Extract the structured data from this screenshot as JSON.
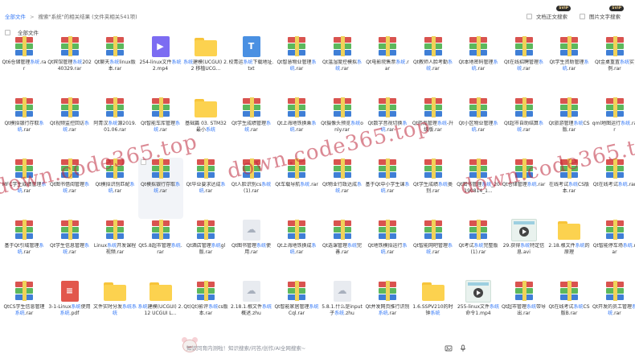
{
  "header": {
    "breadcrumb_root": "全部文件",
    "breadcrumb_sep": ">",
    "breadcrumb_current": "搜索\"系统\"的相关结果 (文件夹相关541项)",
    "option_fulltext": "文档正文搜索",
    "option_image": "图片文字搜索",
    "svip_badge": "SVIP",
    "select_all": "全部文件"
  },
  "watermark": "down.code365.top",
  "items": [
    {
      "icon": "rar",
      "name": "Qt6仓储管理系统.rar"
    },
    {
      "icon": "rar",
      "name": "Qt宾馆管理系统20240329.rar"
    },
    {
      "icon": "rar",
      "name": "Qt聊天系统linux版本.rar"
    },
    {
      "icon": "video",
      "name": "254-linux文件系统2.mp4"
    },
    {
      "icon": "folder",
      "name": "系统建模(UCGUI) 2.2 移植UCG..."
    },
    {
      "icon": "txt",
      "name": "校青运系统下载地址.txt"
    },
    {
      "icon": "rar",
      "name": "Qt智慧物业管理系统.rar"
    },
    {
      "icon": "rar",
      "name": "Qt温湿度控模拟系统.rar"
    },
    {
      "icon": "rar",
      "name": "Qt电影院售票系统.rar"
    },
    {
      "icon": "rar",
      "name": "Qt教师人脸考勤系统.rar"
    },
    {
      "icon": "rar",
      "name": "Qt本地密码管理系统.rar"
    },
    {
      "icon": "rar",
      "name": "Qt在线招聘管理系统.rar"
    },
    {
      "icon": "rar",
      "name": "Qt学生资助管理系统.rar"
    },
    {
      "icon": "rar",
      "name": "Qt金桌重置系统实例.rar"
    },
    {
      "icon": "rar",
      "name": "Qt模拟银行存取系统.rar"
    },
    {
      "icon": "rar",
      "name": "Qt视频监控回访系统.rar"
    },
    {
      "icon": "rar",
      "name": "阿青汉系统源2019.01.06.rar"
    },
    {
      "icon": "rar",
      "name": "Qt智能车库管理系统.rar"
    },
    {
      "icon": "folder",
      "name": "基础篇 03. STM32 最小系统"
    },
    {
      "icon": "rar",
      "name": "Qt学生成绩管理系统.rar"
    },
    {
      "icon": "rar",
      "name": "Qt上海地铁换乘系统.rar"
    },
    {
      "icon": "rar",
      "name": "Qt摄像头预览系统only.rar"
    },
    {
      "icon": "rar",
      "name": "Qt数字音视切换系统.rar"
    },
    {
      "icon": "rar",
      "name": "Qt药品管理系统-升级版.rar"
    },
    {
      "icon": "rar",
      "name": "Qt小区物业管理系统.rar"
    },
    {
      "icon": "rar",
      "name": "Qt超市自助结算系统.rar"
    },
    {
      "icon": "rar",
      "name": "Qt旅游管理系统CS版.rar"
    },
    {
      "icon": "rar",
      "name": "qml地图运行系统.rar"
    },
    {
      "icon": "rar",
      "name": "MFC学生成绩管理系统.rar"
    },
    {
      "icon": "rar",
      "name": "Qt图书借阅管理系统.rar"
    },
    {
      "icon": "rar",
      "name": "Qt模拟识别匹配系统.rar"
    },
    {
      "icon": "rar",
      "name": "Qt模拟银行存取系统.rar",
      "hover": true
    },
    {
      "icon": "rar",
      "name": "Qt毕业要求达成系统.rar"
    },
    {
      "icon": "rar",
      "name": "Qt人脸识别cs系统(1).rar"
    },
    {
      "icon": "rar",
      "name": "Qt车载导航系统.rar"
    },
    {
      "icon": "rar",
      "name": "Qt物业行政达成系统.rar"
    },
    {
      "icon": "rar",
      "name": "基于Qt中小学生课系统.rar"
    },
    {
      "icon": "rar",
      "name": "Qt学生成绩系统类别.rar"
    },
    {
      "icon": "rar",
      "name": "Qt图书管理系统_20190814_1..."
    },
    {
      "icon": "rar",
      "name": "Qt仓储管理系统.rar"
    },
    {
      "icon": "rar",
      "name": "在线考试系统CS版本.rar"
    },
    {
      "icon": "rar",
      "name": "Qt在线考试系统.rar"
    },
    {
      "icon": "rar",
      "name": "基于Qt引域管理系统.rar"
    },
    {
      "icon": "rar",
      "name": "Qt学生信息管理系统.rar"
    },
    {
      "icon": "rar",
      "name": "Linux系统开发课程视频.rar"
    },
    {
      "icon": "rar",
      "name": "Qt5.8超市管理系统.rar"
    },
    {
      "icon": "rar",
      "name": "Qt酒店管理系统gl版.rar"
    },
    {
      "icon": "cloud",
      "name": "Qt图书管理系统使用.rar"
    },
    {
      "icon": "rar",
      "name": "Qt上海地铁换成系统.rar"
    },
    {
      "icon": "rar",
      "name": "Qt选课管理系统完善.rar"
    },
    {
      "icon": "rar",
      "name": "Qt地铁模拟运行系统.rar"
    },
    {
      "icon": "rar",
      "name": "Qt智能网吧管理系统.rar"
    },
    {
      "icon": "rar",
      "name": "Qt考试系统完整版(1).rar"
    },
    {
      "icon": "thumb",
      "name": "29.获得系统特定信息.avi"
    },
    {
      "icon": "folder",
      "name": "2.18.根文件系统的原理"
    },
    {
      "icon": "rar",
      "name": "Qt智能停车场系统.rar"
    },
    {
      "icon": "rar",
      "name": "QtCS学生信息管理系统.rar"
    },
    {
      "icon": "pdf",
      "name": "3-1-Linux系统使用系统.pdf"
    },
    {
      "icon": "folder",
      "name": "文件实时分发系统系统"
    },
    {
      "icon": "folder",
      "name": "系统建模(UCGUI) 2.12 UCGUI L..."
    },
    {
      "icon": "rar",
      "name": "Qt(Qt)影评系统cs版本.rar"
    },
    {
      "icon": "cloud",
      "name": "2.18.1.根文件系统概述.zhu"
    },
    {
      "icon": "rar",
      "name": "Qt智能家居管理系统Cql.rar"
    },
    {
      "icon": "cloud",
      "name": "5.8.1.什么是input子系统.zhu"
    },
    {
      "icon": "rar",
      "name": "Qt并发网页推行识别系统.rar"
    },
    {
      "icon": "folder",
      "name": "1.6.SSPV210的时钟系统"
    },
    {
      "icon": "thumb",
      "name": "255-linux文件系统命令1.mp4"
    },
    {
      "icon": "rar",
      "name": "Qt超市管理系统带导出.rar"
    },
    {
      "icon": "rar",
      "name": "Qt在线考试系统CS版B.rar"
    },
    {
      "icon": "rar",
      "name": "Qt开发的员工管理系统.rar"
    }
  ],
  "bottom": {
    "assistant_text": "知识同育内测啦！知识搜索/问答/创作/AI全网搜索~"
  }
}
